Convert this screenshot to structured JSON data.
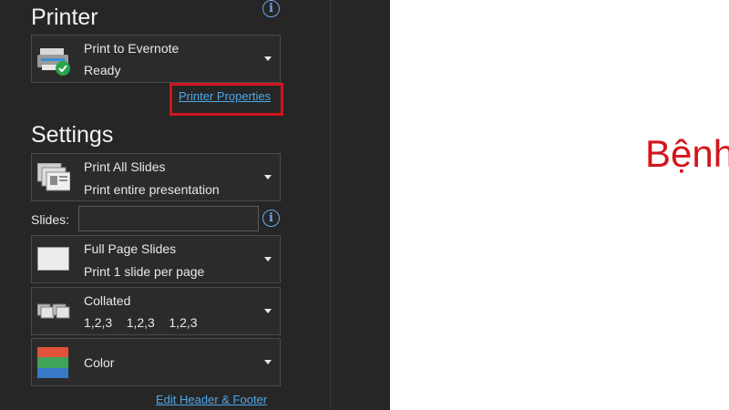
{
  "printer": {
    "section_title": "Printer",
    "selected_name": "Print to Evernote",
    "status": "Ready",
    "properties_link": "Printer Properties"
  },
  "settings": {
    "section_title": "Settings",
    "print_range": {
      "line1": "Print All Slides",
      "line2": "Print entire presentation"
    },
    "slides_label": "Slides:",
    "slides_value": "",
    "layout": {
      "line1": "Full Page Slides",
      "line2": "Print 1 slide per page"
    },
    "collation": {
      "line1": "Collated",
      "line2": "1,2,3    1,2,3    1,2,3"
    },
    "color": {
      "line1": "Color"
    },
    "header_footer_link": "Edit Header & Footer"
  },
  "info_icon_glyph": "i",
  "preview": {
    "text": "Bệnh"
  },
  "colors": {
    "accent_link": "#4ea7e8",
    "highlight": "#d4151c",
    "background": "#262626",
    "preview_bg": "#ffffff"
  }
}
